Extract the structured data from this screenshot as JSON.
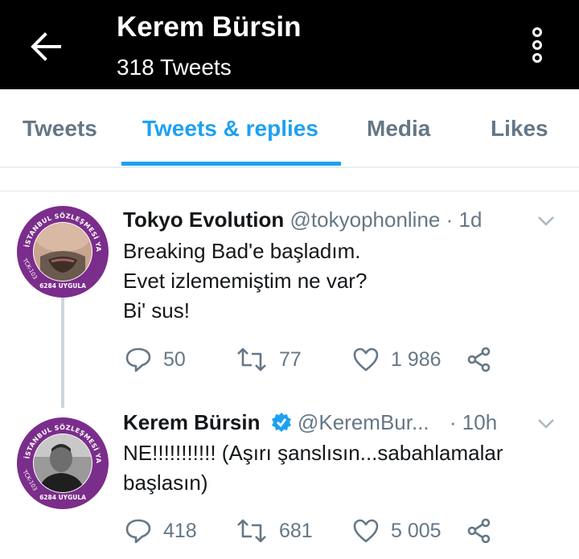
{
  "header": {
    "title": "Kerem Bürsin",
    "tweet_count": "318 Tweets",
    "back_icon": "arrow-left-icon",
    "more_icon": "more-vertical-icon"
  },
  "tabs": [
    {
      "label": "Tweets",
      "active": false
    },
    {
      "label": "Tweets & replies",
      "active": true
    },
    {
      "label": "Media",
      "active": false
    },
    {
      "label": "Likes",
      "active": false
    }
  ],
  "colors": {
    "accent": "#1da1f2",
    "header_bg": "#000000",
    "avatar_ring": "#7b2d8b"
  },
  "tweets": [
    {
      "name": "Tokyo Evolution",
      "handle": "@tokyophonline",
      "separator": "·",
      "time": "1d",
      "lines": [
        "Breaking Bad'e başladım.",
        "Evet izlememiştim ne var?",
        "Bi' sus!"
      ],
      "replies": "50",
      "retweets": "77",
      "likes": "1 986",
      "avatar_text": {
        "top": "İSTANBUL SÖZLEŞMESİ YAŞATIR",
        "left": "TCK-103",
        "bottom": "6284 UYGULA"
      }
    },
    {
      "name": "Kerem Bürsin",
      "handle": "@KeremBur...",
      "separator": "·",
      "time": "10h",
      "verified": true,
      "lines": [
        "NE!!!!!!!!!!! (Aşırı şanslısın...sabahlamalar",
        "başlasın)"
      ],
      "replies": "418",
      "retweets": "681",
      "likes": "5 005",
      "avatar_text": {
        "top": "İSTANBUL SÖZLEŞMESİ YAŞATIR",
        "left": "TCK-103",
        "bottom": "6284 UYGULA"
      }
    }
  ]
}
